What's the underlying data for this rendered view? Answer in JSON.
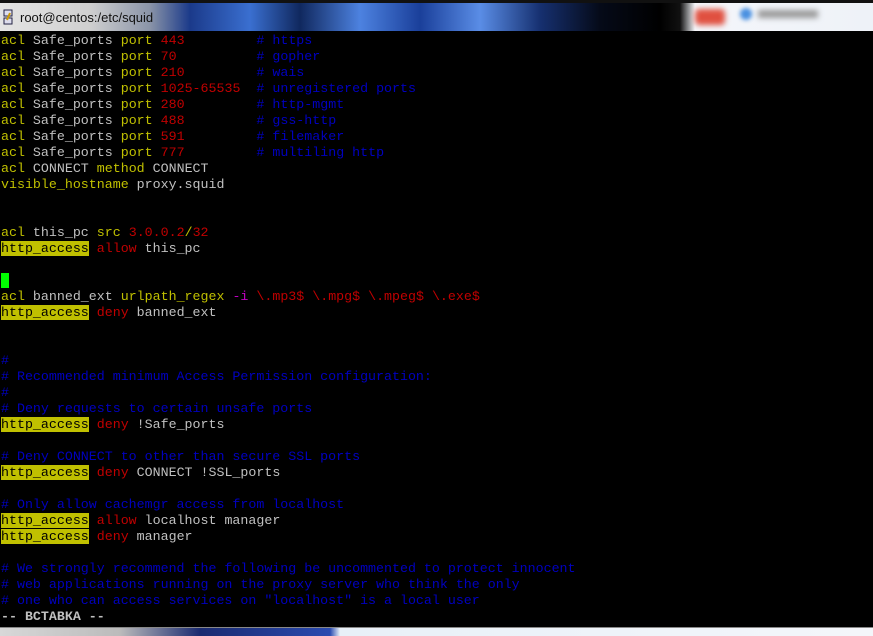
{
  "window": {
    "title": "root@centos:/etc/squid"
  },
  "editor": {
    "mode": "-- ВСТАВКА --",
    "lines": [
      [
        [
          "acl",
          "kw"
        ],
        [
          " Safe_ports ",
          ""
        ],
        [
          "port",
          "kw"
        ],
        [
          " ",
          ""
        ],
        [
          "443",
          "num"
        ],
        [
          "         ",
          ""
        ],
        [
          "# https",
          "cm"
        ]
      ],
      [
        [
          "acl",
          "kw"
        ],
        [
          " Safe_ports ",
          ""
        ],
        [
          "port",
          "kw"
        ],
        [
          " ",
          ""
        ],
        [
          "70",
          "num"
        ],
        [
          "          ",
          ""
        ],
        [
          "# gopher",
          "cm"
        ]
      ],
      [
        [
          "acl",
          "kw"
        ],
        [
          " Safe_ports ",
          ""
        ],
        [
          "port",
          "kw"
        ],
        [
          " ",
          ""
        ],
        [
          "210",
          "num"
        ],
        [
          "         ",
          ""
        ],
        [
          "# wais",
          "cm"
        ]
      ],
      [
        [
          "acl",
          "kw"
        ],
        [
          " Safe_ports ",
          ""
        ],
        [
          "port",
          "kw"
        ],
        [
          " ",
          ""
        ],
        [
          "1025-65535",
          "num"
        ],
        [
          "  ",
          ""
        ],
        [
          "# unregistered ports",
          "cm"
        ]
      ],
      [
        [
          "acl",
          "kw"
        ],
        [
          " Safe_ports ",
          ""
        ],
        [
          "port",
          "kw"
        ],
        [
          " ",
          ""
        ],
        [
          "280",
          "num"
        ],
        [
          "         ",
          ""
        ],
        [
          "# http-mgmt",
          "cm"
        ]
      ],
      [
        [
          "acl",
          "kw"
        ],
        [
          " Safe_ports ",
          ""
        ],
        [
          "port",
          "kw"
        ],
        [
          " ",
          ""
        ],
        [
          "488",
          "num"
        ],
        [
          "         ",
          ""
        ],
        [
          "# gss-http",
          "cm"
        ]
      ],
      [
        [
          "acl",
          "kw"
        ],
        [
          " Safe_ports ",
          ""
        ],
        [
          "port",
          "kw"
        ],
        [
          " ",
          ""
        ],
        [
          "591",
          "num"
        ],
        [
          "         ",
          ""
        ],
        [
          "# filemaker",
          "cm"
        ]
      ],
      [
        [
          "acl",
          "kw"
        ],
        [
          " Safe_ports ",
          ""
        ],
        [
          "port",
          "kw"
        ],
        [
          " ",
          ""
        ],
        [
          "777",
          "num"
        ],
        [
          "         ",
          ""
        ],
        [
          "# multiling http",
          "cm"
        ]
      ],
      [
        [
          "acl",
          "kw"
        ],
        [
          " CONNECT ",
          ""
        ],
        [
          "method",
          "kw"
        ],
        [
          " CONNECT",
          ""
        ]
      ],
      [
        [
          "visible_hostname",
          "kw"
        ],
        [
          " proxy.squid",
          ""
        ]
      ],
      [],
      [],
      [
        [
          "acl",
          "kw"
        ],
        [
          " this_pc ",
          ""
        ],
        [
          "src",
          "kw"
        ],
        [
          " ",
          ""
        ],
        [
          "3.0.0.2",
          "num"
        ],
        [
          "/",
          "sl"
        ],
        [
          "32",
          "num"
        ]
      ],
      [
        [
          "http_access",
          "hl"
        ],
        [
          " ",
          ""
        ],
        [
          "allow",
          "act"
        ],
        [
          " this_pc",
          ""
        ]
      ],
      [],
      [
        [
          "__cursor__",
          "cursor"
        ]
      ],
      [
        [
          "acl",
          "kw"
        ],
        [
          " banned_ext ",
          ""
        ],
        [
          "urlpath_regex",
          "kw"
        ],
        [
          " ",
          ""
        ],
        [
          "-i",
          "opt"
        ],
        [
          " ",
          ""
        ],
        [
          "\\.mp3$ \\.mpg$ \\.mpeg$ \\.exe$",
          "num"
        ]
      ],
      [
        [
          "http_access",
          "hl"
        ],
        [
          " ",
          ""
        ],
        [
          "deny",
          "act"
        ],
        [
          " banned_ext",
          ""
        ]
      ],
      [],
      [],
      [
        [
          "#",
          "cm"
        ]
      ],
      [
        [
          "# Recommended minimum Access Permission configuration:",
          "cm"
        ]
      ],
      [
        [
          "#",
          "cm"
        ]
      ],
      [
        [
          "# Deny requests to certain unsafe ports",
          "cm"
        ]
      ],
      [
        [
          "http_access",
          "hl"
        ],
        [
          " ",
          ""
        ],
        [
          "deny",
          "act"
        ],
        [
          " !Safe_ports",
          ""
        ]
      ],
      [],
      [
        [
          "# Deny CONNECT to other than secure SSL ports",
          "cm"
        ]
      ],
      [
        [
          "http_access",
          "hl"
        ],
        [
          " ",
          ""
        ],
        [
          "deny",
          "act"
        ],
        [
          " CONNECT !SSL_ports",
          ""
        ]
      ],
      [],
      [
        [
          "# Only allow cachemgr access from localhost",
          "cm"
        ]
      ],
      [
        [
          "http_access",
          "hl"
        ],
        [
          " ",
          ""
        ],
        [
          "allow",
          "act"
        ],
        [
          " localhost manager",
          ""
        ]
      ],
      [
        [
          "http_access",
          "hl"
        ],
        [
          " ",
          ""
        ],
        [
          "deny",
          "act"
        ],
        [
          " manager",
          ""
        ]
      ],
      [],
      [
        [
          "# We strongly recommend the following be uncommented to protect innocent",
          "cm"
        ]
      ],
      [
        [
          "# web applications running on the proxy server who think the only",
          "cm"
        ]
      ],
      [
        [
          "# one who can access services on \"localhost\" is a local user",
          "cm"
        ]
      ]
    ]
  },
  "colors": {
    "keyword": "#c0c000",
    "number": "#c00000",
    "comment": "#0000c0",
    "text": "#c0c0c0",
    "cursor": "#00ff00"
  }
}
